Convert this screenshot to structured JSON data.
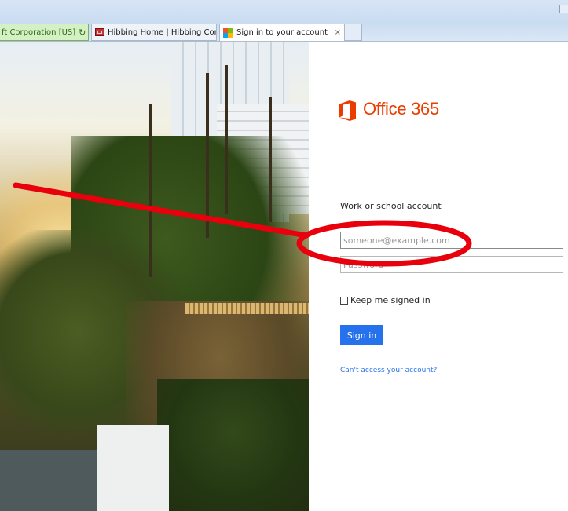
{
  "browser": {
    "tabs": [
      {
        "label": "ft Corporation [US]",
        "icon": "reload-icon"
      },
      {
        "label": "Hibbing Home | Hibbing Com...",
        "icon": "hibbing-favicon"
      },
      {
        "label": "Sign in to your account",
        "icon": "microsoft-favicon",
        "close": "×"
      }
    ]
  },
  "signin": {
    "brand": "Office 365",
    "brand_color": "#eb3c00",
    "account_label": "Work or school account",
    "email_placeholder": "someone@example.com",
    "email_value": "",
    "password_placeholder": "Password",
    "keep_signed_in": "Keep me signed in",
    "keep_checked": false,
    "signin_button": "Sign in",
    "button_color": "#2672ec",
    "cant_access": "Can't access your account?"
  },
  "annotation": {
    "color": "#e8000d"
  }
}
